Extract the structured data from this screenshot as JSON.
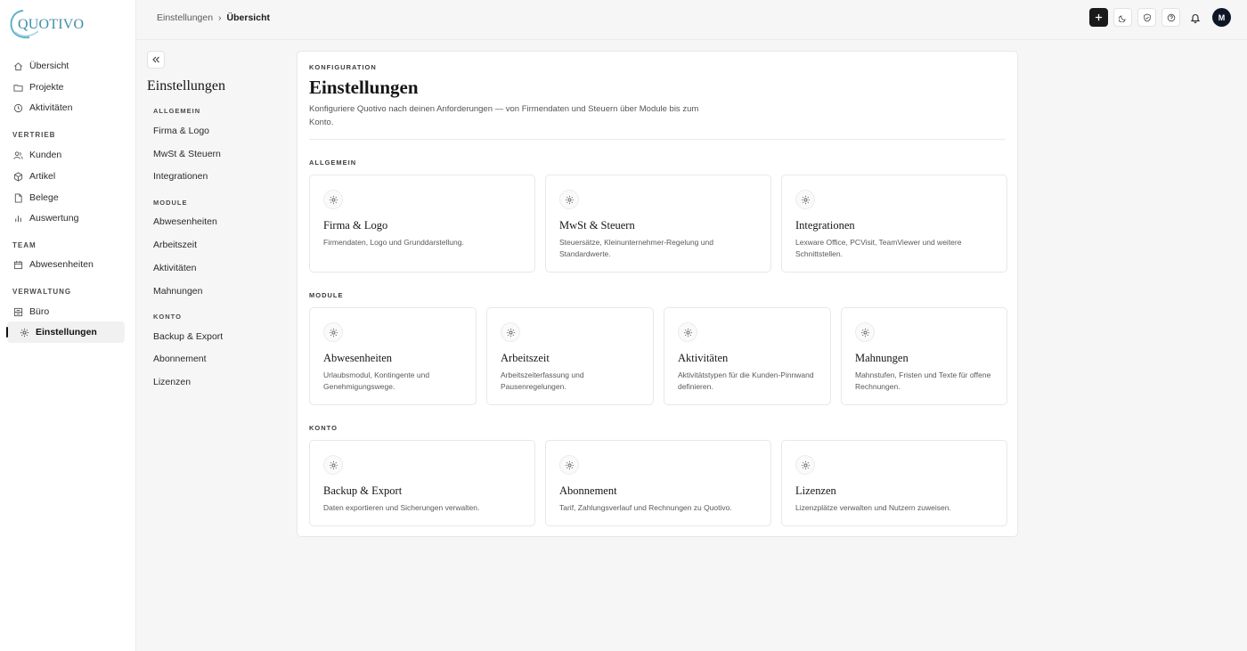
{
  "app": {
    "logo_text": "QUOTIVO",
    "brand_color": "#3d8fa8"
  },
  "sidebar": {
    "items": [
      {
        "label": "Übersicht",
        "icon": "home-icon"
      },
      {
        "label": "Projekte",
        "icon": "folder-icon"
      },
      {
        "label": "Aktivitäten",
        "icon": "clock-icon"
      }
    ],
    "sections": [
      {
        "label": "VERTRIEB",
        "items": [
          {
            "label": "Kunden",
            "icon": "users-icon"
          },
          {
            "label": "Artikel",
            "icon": "box-icon"
          },
          {
            "label": "Belege",
            "icon": "file-icon"
          },
          {
            "label": "Auswertung",
            "icon": "bar-chart-icon"
          }
        ]
      },
      {
        "label": "TEAM",
        "items": [
          {
            "label": "Abwesenheiten",
            "icon": "calendar-icon"
          }
        ]
      },
      {
        "label": "VERWALTUNG",
        "items": [
          {
            "label": "Büro",
            "icon": "office-icon"
          },
          {
            "label": "Einstellungen",
            "icon": "gear-icon",
            "active": true
          }
        ]
      }
    ]
  },
  "topbar": {
    "breadcrumb": {
      "parent": "Einstellungen",
      "separator": "›",
      "current": "Übersicht"
    },
    "avatar_initial": "M"
  },
  "subnav": {
    "title": "Einstellungen",
    "groups": [
      {
        "label": "ALLGEMEIN",
        "items": [
          "Firma & Logo",
          "MwSt & Steuern",
          "Integrationen"
        ]
      },
      {
        "label": "MODULE",
        "items": [
          "Abwesenheiten",
          "Arbeitszeit",
          "Aktivitäten",
          "Mahnungen"
        ]
      },
      {
        "label": "KONTO",
        "items": [
          "Backup & Export",
          "Abonnement",
          "Lizenzen"
        ]
      }
    ]
  },
  "main": {
    "eyebrow": "KONFIGURATION",
    "title": "Einstellungen",
    "description": "Konfiguriere Quotivo nach deinen Anforderungen — von Firmendaten und Steuern über Module bis zum Konto.",
    "groups": [
      {
        "label": "ALLGEMEIN",
        "cards": [
          {
            "title": "Firma & Logo",
            "desc": "Firmendaten, Logo und Grunddarstellung."
          },
          {
            "title": "MwSt & Steuern",
            "desc": "Steuersätze, Kleinunternehmer-Regelung und Standardwerte."
          },
          {
            "title": "Integrationen",
            "desc": "Lexware Office, PCVisit, TeamViewer und weitere Schnittstellen."
          }
        ]
      },
      {
        "label": "MODULE",
        "cards": [
          {
            "title": "Abwesenheiten",
            "desc": "Urlaubsmodul, Kontingente und Genehmigungswege."
          },
          {
            "title": "Arbeitszeit",
            "desc": "Arbeitszeiterfassung und Pausenregelungen."
          },
          {
            "title": "Aktivitäten",
            "desc": "Aktivitätstypen für die Kunden-Pinnwand definieren."
          },
          {
            "title": "Mahnungen",
            "desc": "Mahnstufen, Fristen und Texte für offene Rechnungen."
          }
        ]
      },
      {
        "label": "KONTO",
        "cards": [
          {
            "title": "Backup & Export",
            "desc": "Daten exportieren und Sicherungen verwalten."
          },
          {
            "title": "Abonnement",
            "desc": "Tarif, Zahlungsverlauf und Rechnungen zu Quotivo."
          },
          {
            "title": "Lizenzen",
            "desc": "Lizenzplätze verwalten und Nutzern zuweisen."
          }
        ]
      }
    ]
  }
}
